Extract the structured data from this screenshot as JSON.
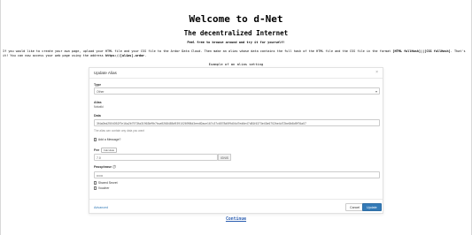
{
  "page": {
    "title": "Welcome to d-Net",
    "subtitle": "The decentralized Internet",
    "tagline": "Feel free to browse around and try it for yourself!",
    "intro_1": "If you would like to create your own page, upload your HTML file and your CSS file to the Ardor Data Cloud. Then make an alias whose data contains the full hash of the HTML file and the CSS file in the format ",
    "intro_format": "[HTML fullHash]||[CSS fullHash]",
    "intro_2": ". That's it! You can now access your web page using the address ",
    "intro_address": "https://[alias].ardor",
    "intro_2_end": ".",
    "caption": "Example of an alias setting",
    "continue": "Continue"
  },
  "modal": {
    "title": "Update Alias",
    "close": "×",
    "type_label": "Type",
    "type_value": "Other",
    "alias_label": "Alias",
    "alias_value": "Nxtwiki",
    "data_label": "Data",
    "data_value": "3f4a0bd2504052f7e16a2b7573fa31963bf9b7bca9268485d9391026998d3eedf2ace167c37c6578d0f9d04d7ed6e47d81f4373e43e6702be4d72be8b8d9f76a07",
    "data_hint": "The alias can contain any data you want",
    "add_message": "Add a Message?",
    "fee_label": "Fee",
    "fee_pill": "Calculate",
    "fee_value": "7.0",
    "fee_unit": "IGNIS",
    "passphrase_label": "Passphrase",
    "passphrase_value": "••••••",
    "shared_secret": "Shared Secret",
    "voucher": "Voucher",
    "advanced": "Advanced",
    "cancel": "Cancel",
    "update": "Update"
  }
}
